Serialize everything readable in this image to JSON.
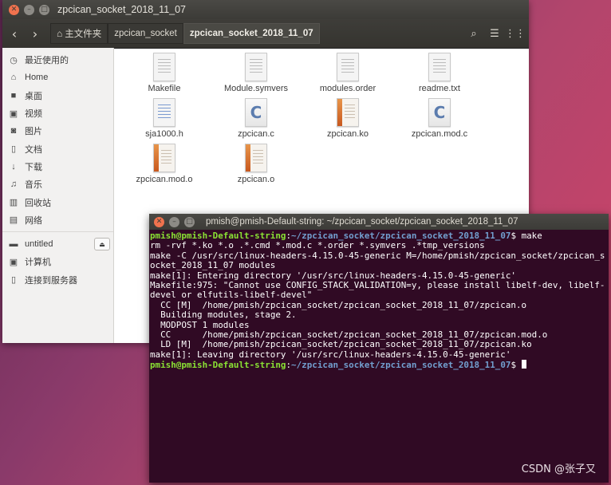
{
  "file_manager": {
    "title": "zpcican_socket_2018_11_07",
    "breadcrumbs": [
      "主文件夹",
      "zpcican_socket",
      "zpcican_socket_2018_11_07"
    ],
    "sidebar": [
      {
        "label": "最近使用的",
        "icon": "clock-icon"
      },
      {
        "label": "Home",
        "icon": "home-icon"
      },
      {
        "label": "桌面",
        "icon": "folder-icon"
      },
      {
        "label": "视频",
        "icon": "video-icon"
      },
      {
        "label": "图片",
        "icon": "camera-icon"
      },
      {
        "label": "文档",
        "icon": "document-icon"
      },
      {
        "label": "下载",
        "icon": "download-icon"
      },
      {
        "label": "音乐",
        "icon": "music-icon"
      },
      {
        "label": "回收站",
        "icon": "trash-icon"
      },
      {
        "label": "网络",
        "icon": "network-icon"
      }
    ],
    "devices": [
      {
        "label": "untitled",
        "icon": "drive-icon"
      },
      {
        "label": "计算机",
        "icon": "computer-icon"
      },
      {
        "label": "连接到服务器",
        "icon": "server-icon"
      }
    ],
    "files": [
      {
        "name": "Makefile",
        "type": "text"
      },
      {
        "name": "Module.symvers",
        "type": "text"
      },
      {
        "name": "modules.order",
        "type": "text"
      },
      {
        "name": "readme.txt",
        "type": "text"
      },
      {
        "name": "sja1000.h",
        "type": "header"
      },
      {
        "name": "zpcican.c",
        "type": "c"
      },
      {
        "name": "zpcican.ko",
        "type": "object"
      },
      {
        "name": "zpcican.mod.c",
        "type": "c"
      },
      {
        "name": "zpcican.mod.o",
        "type": "object"
      },
      {
        "name": "zpcican.o",
        "type": "object"
      }
    ]
  },
  "terminal": {
    "title": "pmish@pmish-Default-string: ~/zpcican_socket/zpcican_socket_2018_11_07",
    "prompt_user": "pmish@pmish-Default-string",
    "prompt_path": "~/zpcican_socket/zpcican_socket_2018_11_07",
    "command": "make",
    "output": [
      "rm -rvf *.ko *.o .*.cmd *.mod.c *.order *.symvers .*tmp_versions",
      "make -C /usr/src/linux-headers-4.15.0-45-generic M=/home/pmish/zpcican_socket/zpcican_socket_2018_11_07 modules",
      "make[1]: Entering directory '/usr/src/linux-headers-4.15.0-45-generic'",
      "Makefile:975: \"Cannot use CONFIG_STACK_VALIDATION=y, please install libelf-dev, libelf-devel or elfutils-libelf-devel\"",
      "  CC [M]  /home/pmish/zpcican_socket/zpcican_socket_2018_11_07/zpcican.o",
      "  Building modules, stage 2.",
      "  MODPOST 1 modules",
      "  CC      /home/pmish/zpcican_socket/zpcican_socket_2018_11_07/zpcican.mod.o",
      "  LD [M]  /home/pmish/zpcican_socket/zpcican_socket_2018_11_07/zpcican.ko",
      "make[1]: Leaving directory '/usr/src/linux-headers-4.15.0-45-generic'"
    ]
  },
  "watermark": "CSDN @张子又"
}
